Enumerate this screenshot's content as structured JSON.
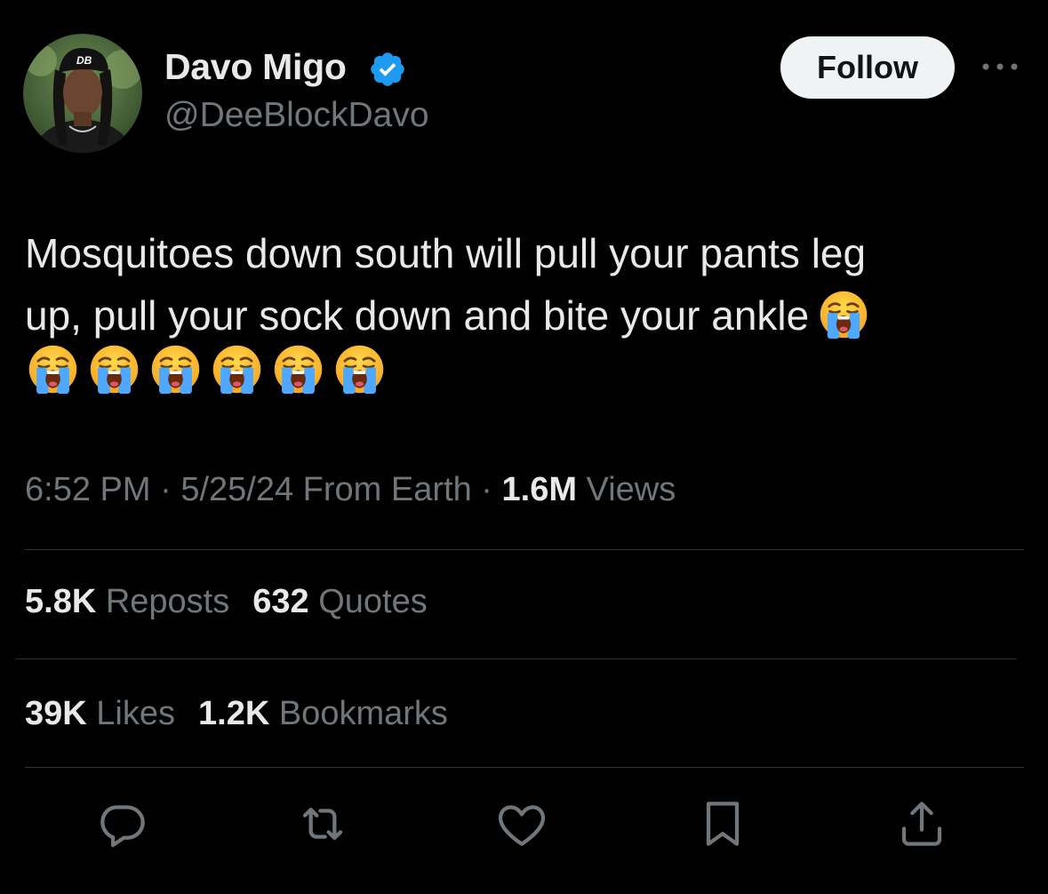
{
  "author": {
    "display_name": "Davo Migo",
    "handle": "@DeeBlockDavo",
    "verified": true,
    "avatar_icon": "profile-photo"
  },
  "follow_label": "Follow",
  "more_icon": "more-horizontal-icon",
  "tweet": {
    "line1": "Mosquitoes down south will pull your pants leg",
    "line2": "up, pull your sock down and bite your ankle",
    "emoji_name": "loudly-crying-face",
    "emoji_count_total": 7
  },
  "meta": {
    "time": "6:52 PM",
    "sep1": " · ",
    "date": "5/25/24",
    "location": " From Earth",
    "sep2": " · ",
    "views_count": "1.6M",
    "views_label": " Views"
  },
  "stats": {
    "reposts_count": "5.8K",
    "reposts_label": " Reposts",
    "quotes_count": "632",
    "quotes_label": " Quotes",
    "likes_count": "39K",
    "likes_label": " Likes",
    "bookmarks_count": "1.2K",
    "bookmarks_label": " Bookmarks"
  },
  "actions": [
    "reply-icon",
    "repost-icon",
    "like-icon",
    "bookmark-icon",
    "share-icon"
  ],
  "colors": {
    "background": "#000000",
    "primary_text": "#e7e9ea",
    "secondary_text": "#71767b",
    "verified_blue": "#1d9bf0",
    "divider": "#2f3336",
    "follow_bg": "#eff3f4"
  }
}
